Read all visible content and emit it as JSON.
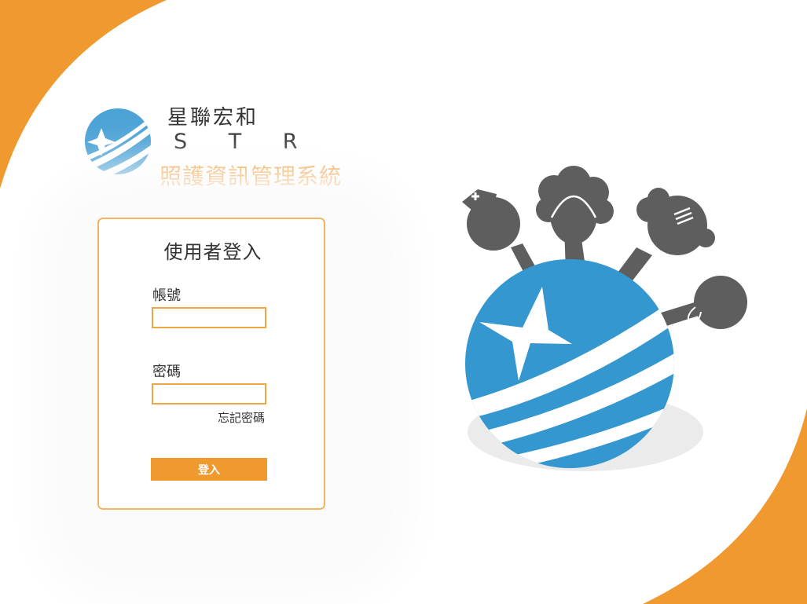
{
  "brand": {
    "company_name": "星聯宏和",
    "abbreviation": "S T R",
    "system_name": "照護資訊管理系統",
    "logo_icon": "star-globe-logo-icon"
  },
  "login": {
    "title": "使用者登入",
    "account_label": "帳號",
    "account_value": "",
    "password_label": "密碼",
    "password_value": "",
    "forgot_label": "忘記密碼",
    "submit_label": "登入"
  },
  "hero": {
    "illustration_icon": "caregivers-on-globe-icon"
  },
  "colors": {
    "accent_orange": "#f0992e",
    "input_border": "#f0a545",
    "globe_blue": "#3497cf",
    "figure_gray": "#5e5e5e"
  }
}
